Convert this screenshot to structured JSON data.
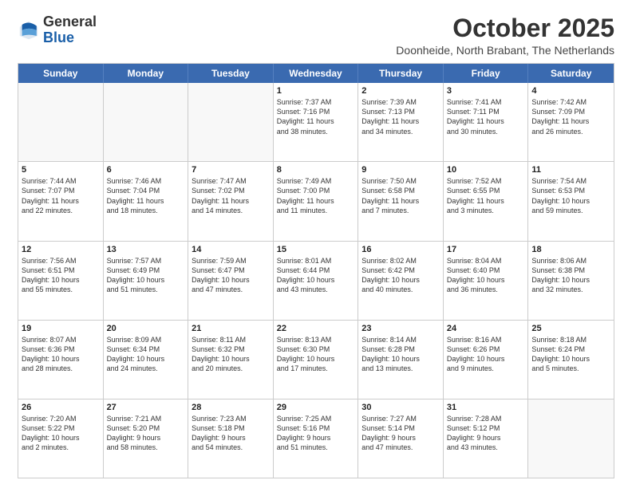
{
  "header": {
    "logo": {
      "general": "General",
      "blue": "Blue"
    },
    "title": "October 2025",
    "location": "Doonheide, North Brabant, The Netherlands"
  },
  "calendar": {
    "days_of_week": [
      "Sunday",
      "Monday",
      "Tuesday",
      "Wednesday",
      "Thursday",
      "Friday",
      "Saturday"
    ],
    "rows": [
      [
        {
          "day": "",
          "empty": true
        },
        {
          "day": "",
          "empty": true
        },
        {
          "day": "",
          "empty": true
        },
        {
          "day": "1",
          "info": "Sunrise: 7:37 AM\nSunset: 7:16 PM\nDaylight: 11 hours\nand 38 minutes."
        },
        {
          "day": "2",
          "info": "Sunrise: 7:39 AM\nSunset: 7:13 PM\nDaylight: 11 hours\nand 34 minutes."
        },
        {
          "day": "3",
          "info": "Sunrise: 7:41 AM\nSunset: 7:11 PM\nDaylight: 11 hours\nand 30 minutes."
        },
        {
          "day": "4",
          "info": "Sunrise: 7:42 AM\nSunset: 7:09 PM\nDaylight: 11 hours\nand 26 minutes."
        }
      ],
      [
        {
          "day": "5",
          "info": "Sunrise: 7:44 AM\nSunset: 7:07 PM\nDaylight: 11 hours\nand 22 minutes."
        },
        {
          "day": "6",
          "info": "Sunrise: 7:46 AM\nSunset: 7:04 PM\nDaylight: 11 hours\nand 18 minutes."
        },
        {
          "day": "7",
          "info": "Sunrise: 7:47 AM\nSunset: 7:02 PM\nDaylight: 11 hours\nand 14 minutes."
        },
        {
          "day": "8",
          "info": "Sunrise: 7:49 AM\nSunset: 7:00 PM\nDaylight: 11 hours\nand 11 minutes."
        },
        {
          "day": "9",
          "info": "Sunrise: 7:50 AM\nSunset: 6:58 PM\nDaylight: 11 hours\nand 7 minutes."
        },
        {
          "day": "10",
          "info": "Sunrise: 7:52 AM\nSunset: 6:55 PM\nDaylight: 11 hours\nand 3 minutes."
        },
        {
          "day": "11",
          "info": "Sunrise: 7:54 AM\nSunset: 6:53 PM\nDaylight: 10 hours\nand 59 minutes."
        }
      ],
      [
        {
          "day": "12",
          "info": "Sunrise: 7:56 AM\nSunset: 6:51 PM\nDaylight: 10 hours\nand 55 minutes."
        },
        {
          "day": "13",
          "info": "Sunrise: 7:57 AM\nSunset: 6:49 PM\nDaylight: 10 hours\nand 51 minutes."
        },
        {
          "day": "14",
          "info": "Sunrise: 7:59 AM\nSunset: 6:47 PM\nDaylight: 10 hours\nand 47 minutes."
        },
        {
          "day": "15",
          "info": "Sunrise: 8:01 AM\nSunset: 6:44 PM\nDaylight: 10 hours\nand 43 minutes."
        },
        {
          "day": "16",
          "info": "Sunrise: 8:02 AM\nSunset: 6:42 PM\nDaylight: 10 hours\nand 40 minutes."
        },
        {
          "day": "17",
          "info": "Sunrise: 8:04 AM\nSunset: 6:40 PM\nDaylight: 10 hours\nand 36 minutes."
        },
        {
          "day": "18",
          "info": "Sunrise: 8:06 AM\nSunset: 6:38 PM\nDaylight: 10 hours\nand 32 minutes."
        }
      ],
      [
        {
          "day": "19",
          "info": "Sunrise: 8:07 AM\nSunset: 6:36 PM\nDaylight: 10 hours\nand 28 minutes."
        },
        {
          "day": "20",
          "info": "Sunrise: 8:09 AM\nSunset: 6:34 PM\nDaylight: 10 hours\nand 24 minutes."
        },
        {
          "day": "21",
          "info": "Sunrise: 8:11 AM\nSunset: 6:32 PM\nDaylight: 10 hours\nand 20 minutes."
        },
        {
          "day": "22",
          "info": "Sunrise: 8:13 AM\nSunset: 6:30 PM\nDaylight: 10 hours\nand 17 minutes."
        },
        {
          "day": "23",
          "info": "Sunrise: 8:14 AM\nSunset: 6:28 PM\nDaylight: 10 hours\nand 13 minutes."
        },
        {
          "day": "24",
          "info": "Sunrise: 8:16 AM\nSunset: 6:26 PM\nDaylight: 10 hours\nand 9 minutes."
        },
        {
          "day": "25",
          "info": "Sunrise: 8:18 AM\nSunset: 6:24 PM\nDaylight: 10 hours\nand 5 minutes."
        }
      ],
      [
        {
          "day": "26",
          "info": "Sunrise: 7:20 AM\nSunset: 5:22 PM\nDaylight: 10 hours\nand 2 minutes."
        },
        {
          "day": "27",
          "info": "Sunrise: 7:21 AM\nSunset: 5:20 PM\nDaylight: 9 hours\nand 58 minutes."
        },
        {
          "day": "28",
          "info": "Sunrise: 7:23 AM\nSunset: 5:18 PM\nDaylight: 9 hours\nand 54 minutes."
        },
        {
          "day": "29",
          "info": "Sunrise: 7:25 AM\nSunset: 5:16 PM\nDaylight: 9 hours\nand 51 minutes."
        },
        {
          "day": "30",
          "info": "Sunrise: 7:27 AM\nSunset: 5:14 PM\nDaylight: 9 hours\nand 47 minutes."
        },
        {
          "day": "31",
          "info": "Sunrise: 7:28 AM\nSunset: 5:12 PM\nDaylight: 9 hours\nand 43 minutes."
        },
        {
          "day": "",
          "empty": true
        }
      ]
    ]
  }
}
